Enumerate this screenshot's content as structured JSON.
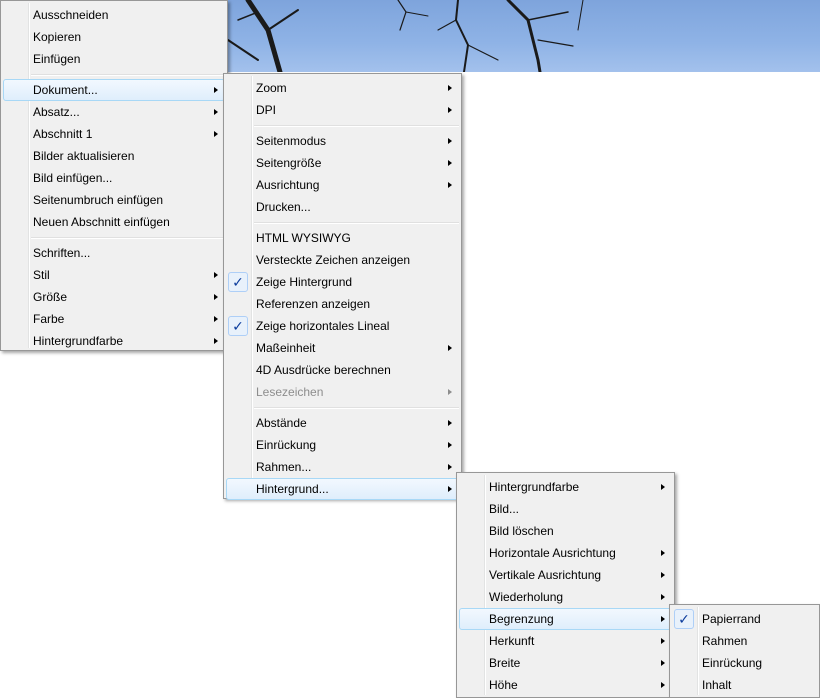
{
  "menu_main": {
    "items": [
      {
        "label": "Ausschneiden"
      },
      {
        "label": "Kopieren"
      },
      {
        "label": "Einfügen"
      },
      {
        "label": "Dokument...",
        "submenu": true,
        "highlighted": true
      },
      {
        "label": "Absatz...",
        "submenu": true
      },
      {
        "label": "Abschnitt 1",
        "submenu": true
      },
      {
        "label": "Bilder aktualisieren"
      },
      {
        "label": "Bild einfügen..."
      },
      {
        "label": "Seitenumbruch einfügen"
      },
      {
        "label": "Neuen Abschnitt einfügen"
      },
      {
        "label": "Schriften..."
      },
      {
        "label": "Stil",
        "submenu": true
      },
      {
        "label": "Größe",
        "submenu": true
      },
      {
        "label": "Farbe",
        "submenu": true
      },
      {
        "label": "Hintergrundfarbe",
        "submenu": true
      }
    ]
  },
  "menu_dokument": {
    "items": [
      {
        "label": "Zoom",
        "submenu": true
      },
      {
        "label": "DPI",
        "submenu": true
      },
      {
        "label": "Seitenmodus",
        "submenu": true
      },
      {
        "label": "Seitengröße",
        "submenu": true
      },
      {
        "label": "Ausrichtung",
        "submenu": true
      },
      {
        "label": "Drucken..."
      },
      {
        "label": "HTML WYSIWYG"
      },
      {
        "label": "Versteckte Zeichen anzeigen"
      },
      {
        "label": "Zeige Hintergrund",
        "checked": true
      },
      {
        "label": "Referenzen anzeigen"
      },
      {
        "label": "Zeige horizontales Lineal",
        "checked": true
      },
      {
        "label": "Maßeinheit",
        "submenu": true
      },
      {
        "label": "4D Ausdrücke berechnen"
      },
      {
        "label": "Lesezeichen",
        "submenu": true,
        "disabled": true
      },
      {
        "label": "Abstände",
        "submenu": true
      },
      {
        "label": "Einrückung",
        "submenu": true
      },
      {
        "label": "Rahmen...",
        "submenu": true
      },
      {
        "label": "Hintergrund...",
        "submenu": true,
        "highlighted": true
      }
    ]
  },
  "menu_hintergrund": {
    "items": [
      {
        "label": "Hintergrundfarbe",
        "submenu": true
      },
      {
        "label": "Bild..."
      },
      {
        "label": "Bild löschen"
      },
      {
        "label": "Horizontale Ausrichtung",
        "submenu": true
      },
      {
        "label": "Vertikale Ausrichtung",
        "submenu": true
      },
      {
        "label": "Wiederholung",
        "submenu": true
      },
      {
        "label": "Begrenzung",
        "submenu": true,
        "highlighted": true
      },
      {
        "label": "Herkunft",
        "submenu": true
      },
      {
        "label": "Breite",
        "submenu": true
      },
      {
        "label": "Höhe",
        "submenu": true
      }
    ]
  },
  "menu_begrenzung": {
    "items": [
      {
        "label": "Papierrand",
        "checked": true
      },
      {
        "label": "Rahmen"
      },
      {
        "label": "Einrückung"
      },
      {
        "label": "Inhalt"
      }
    ]
  },
  "icons": {
    "submenu": "chevron-right-icon",
    "checked": "checkmark-icon"
  },
  "colors": {
    "menu_background": "#f0f0f0",
    "highlight_border": "#a8d8f6",
    "check_color": "#0c3c9c",
    "sky": "#8fb3e6"
  }
}
